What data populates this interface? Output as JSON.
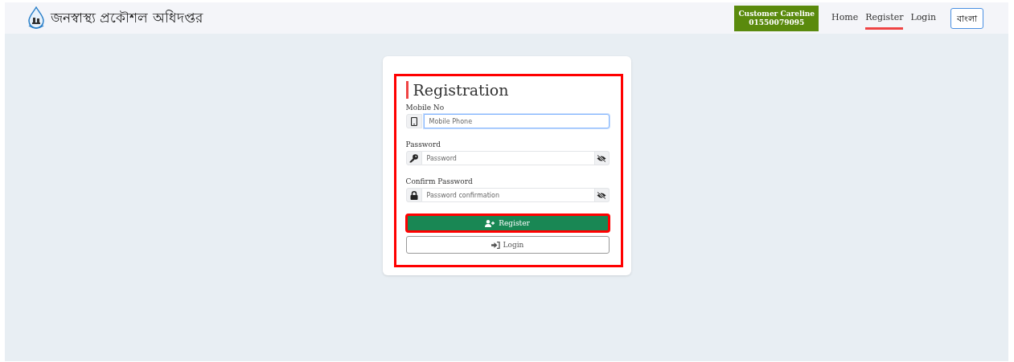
{
  "header": {
    "title": "জনস্বাস্থ্য প্রকৌশল অধিদপ্তর",
    "careline": {
      "label": "Customer Careline",
      "phone": "01550079095"
    },
    "nav": [
      {
        "label": "Home",
        "selected": false
      },
      {
        "label": "Register",
        "selected": true
      },
      {
        "label": "Login",
        "selected": false
      }
    ],
    "language_button": "বাংলা"
  },
  "form": {
    "title": "Registration",
    "highlighted": true,
    "fields": [
      {
        "label": "Mobile No",
        "placeholder": "Mobile Phone",
        "focused": true,
        "visibility_toggle": false
      },
      {
        "label": "Password",
        "placeholder": "Password",
        "focused": false,
        "visibility_toggle": true
      },
      {
        "label": "Confirm Password",
        "placeholder": "Password confirmation",
        "focused": false,
        "visibility_toggle": true
      }
    ],
    "buttons": [
      {
        "label": "Register",
        "kind": "primary",
        "highlighted": true
      },
      {
        "label": "Login",
        "kind": "outline",
        "highlighted": false
      }
    ]
  }
}
